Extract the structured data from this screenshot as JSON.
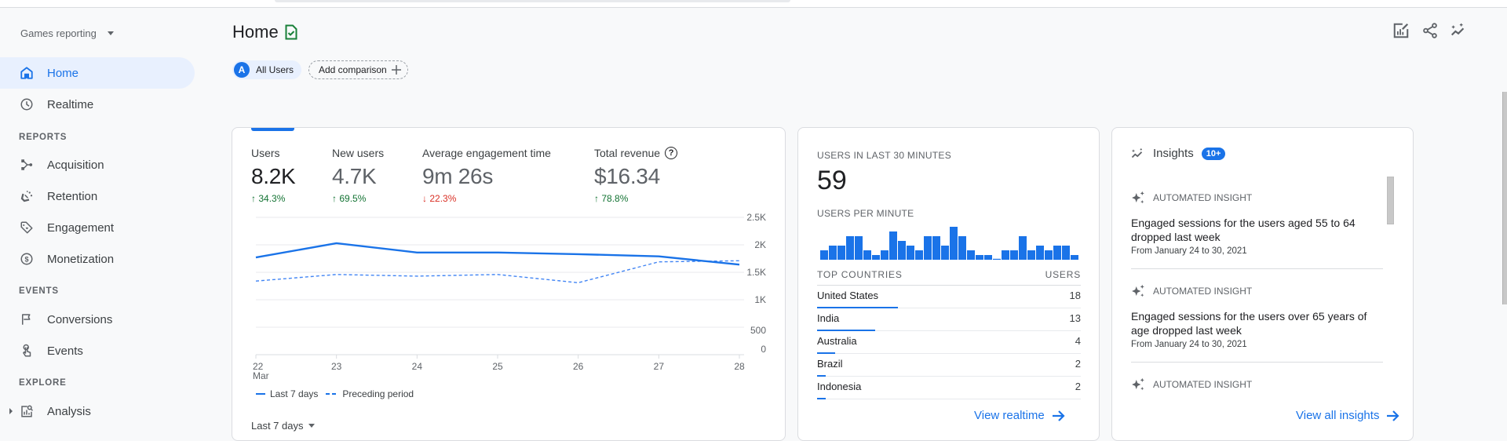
{
  "app": {
    "property_selector": "Games reporting",
    "page_title": "Home"
  },
  "sidebar": {
    "items": [
      {
        "label": "Home",
        "icon": "home-icon",
        "active": true
      },
      {
        "label": "Realtime",
        "icon": "clock-icon"
      }
    ],
    "sections": [
      {
        "title": "REPORTS",
        "items": [
          {
            "label": "Acquisition",
            "icon": "acquisition-icon"
          },
          {
            "label": "Retention",
            "icon": "retention-icon"
          },
          {
            "label": "Engagement",
            "icon": "tag-icon"
          },
          {
            "label": "Monetization",
            "icon": "dollar-icon"
          }
        ]
      },
      {
        "title": "EVENTS",
        "items": [
          {
            "label": "Conversions",
            "icon": "flag-icon"
          },
          {
            "label": "Events",
            "icon": "touch-icon"
          }
        ]
      },
      {
        "title": "EXPLORE",
        "items": [
          {
            "label": "Analysis",
            "icon": "analysis-icon"
          }
        ]
      }
    ]
  },
  "header": {
    "comparison_chip": {
      "avatar": "A",
      "label": "All Users"
    },
    "add_comparison": "Add comparison",
    "actions": [
      "customize-report-icon",
      "share-icon",
      "insights-icon"
    ]
  },
  "overview": {
    "metrics": [
      {
        "label": "Users",
        "value": "8.2K",
        "change": "34.3%",
        "direction": "up",
        "selected": true
      },
      {
        "label": "New users",
        "value": "4.7K",
        "change": "69.5%",
        "direction": "up"
      },
      {
        "label": "Average engagement time",
        "value": "9m 26s",
        "change": "22.3%",
        "direction": "down"
      },
      {
        "label": "Total revenue",
        "value": "$16.34",
        "change": "78.8%",
        "direction": "up",
        "help": "?"
      }
    ],
    "date_range": "Last 7 days",
    "legend": {
      "current": "Last 7 days",
      "previous": "Preceding period"
    }
  },
  "chart_data": {
    "type": "line",
    "title": "",
    "xlabel": "",
    "ylabel": "Users",
    "x": [
      "22",
      "23",
      "24",
      "25",
      "26",
      "27",
      "28"
    ],
    "x_sublabel_first": "Mar",
    "yticks": [
      "0",
      "500",
      "1K",
      "1.5K",
      "2K",
      "2.5K"
    ],
    "ytick_values": [
      0,
      500,
      1000,
      1500,
      2000,
      2500
    ],
    "ylim": [
      0,
      2500
    ],
    "grid": true,
    "y_axis_position": "right",
    "legend_position": "bottom-left",
    "series": [
      {
        "name": "Last 7 days",
        "style": "solid",
        "values": [
          1770,
          2030,
          1860,
          1860,
          1830,
          1790,
          1640
        ]
      },
      {
        "name": "Preceding period",
        "style": "dashed",
        "values": [
          1340,
          1460,
          1430,
          1460,
          1310,
          1690,
          1710
        ]
      }
    ]
  },
  "realtime": {
    "title": "USERS IN LAST 30 MINUTES",
    "value": "59",
    "per_minute_label": "USERS PER MINUTE",
    "per_minute": [
      2,
      3,
      3,
      5,
      5,
      2,
      1,
      2,
      6,
      4,
      3,
      2,
      5,
      5,
      3,
      7,
      5,
      2,
      1,
      1,
      0.2,
      2,
      2,
      5,
      2,
      3,
      2,
      3,
      3,
      1
    ],
    "countries_header": "TOP COUNTRIES",
    "users_header": "USERS",
    "countries": [
      {
        "name": "United States",
        "users": "18",
        "value": 18
      },
      {
        "name": "India",
        "users": "13",
        "value": 13
      },
      {
        "name": "Australia",
        "users": "4",
        "value": 4
      },
      {
        "name": "Brazil",
        "users": "2",
        "value": 2
      },
      {
        "name": "Indonesia",
        "users": "2",
        "value": 2
      }
    ],
    "link": "View realtime"
  },
  "insights": {
    "title": "Insights",
    "badge": "10+",
    "items": [
      {
        "tag": "AUTOMATED INSIGHT",
        "text": "Engaged sessions for the users aged 55 to 64 dropped last week",
        "date": "From January 24 to 30, 2021"
      },
      {
        "tag": "AUTOMATED INSIGHT",
        "text": "Engaged sessions for the users over 65 years of age dropped last week",
        "date": "From January 24 to 30, 2021"
      },
      {
        "tag": "AUTOMATED INSIGHT",
        "text": "",
        "date": ""
      }
    ],
    "link": "View all insights"
  },
  "colors": {
    "accent": "#1a73e8",
    "up": "#137333",
    "down": "#d93025",
    "selected_nav_bg": "#e8f0fe"
  }
}
